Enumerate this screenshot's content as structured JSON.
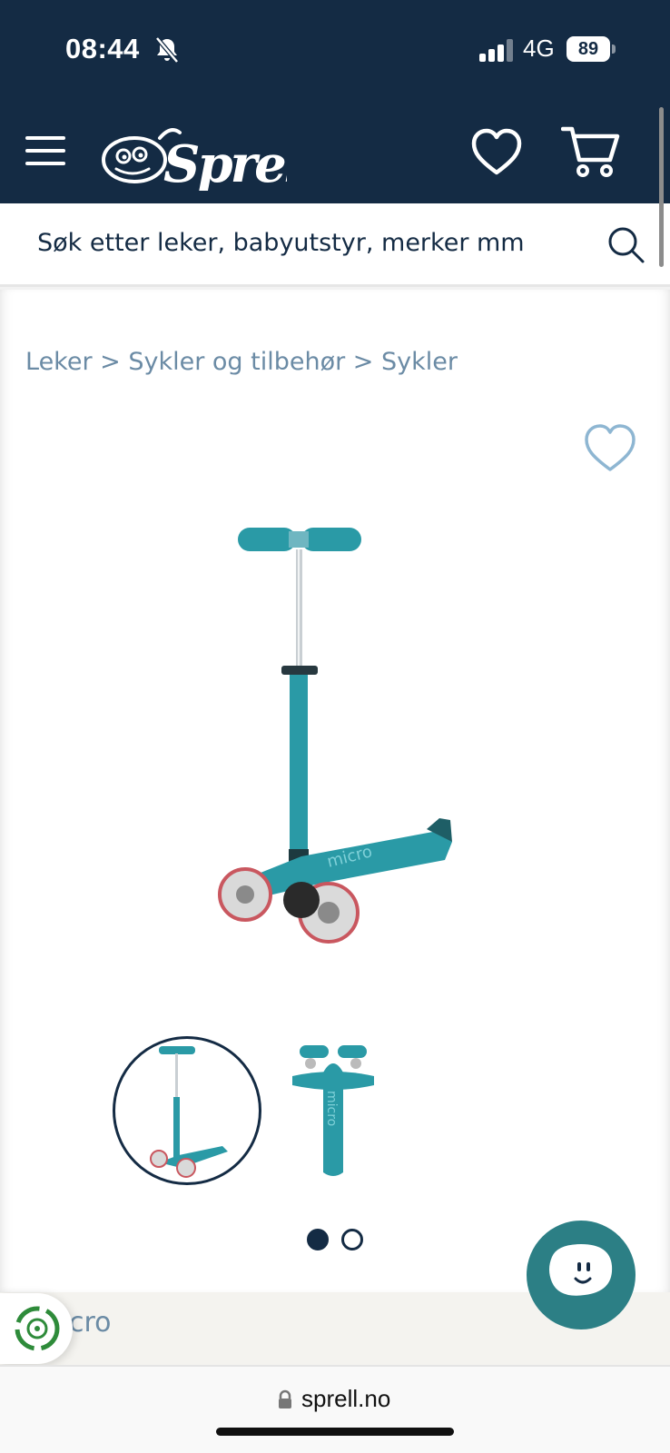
{
  "status_bar": {
    "time": "08:44",
    "network": "4G",
    "battery": "89"
  },
  "header": {
    "logo_alt": "Sprell",
    "icons": [
      "menu-icon",
      "heart-icon",
      "cart-icon"
    ],
    "colors": {
      "navy": "#142b44",
      "accent_teal": "#2c7f85",
      "breadcrumb": "#6b8ba5"
    }
  },
  "search": {
    "placeholder": "Søk etter leker, babyutstyr, merker mm"
  },
  "breadcrumb": {
    "text": "Leker > Sykler og tilbehør > Sykler"
  },
  "gallery": {
    "image_count": 2,
    "active_index": 0
  },
  "brand": {
    "partial_text": "cro"
  },
  "browser": {
    "url": "sprell.no"
  }
}
